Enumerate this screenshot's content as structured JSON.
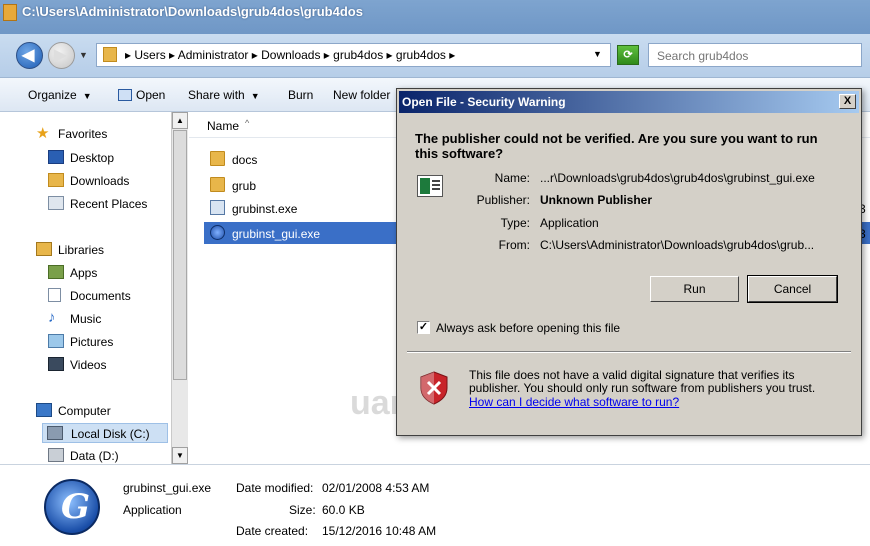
{
  "window": {
    "title": "C:\\Users\\Administrator\\Downloads\\grub4dos\\grub4dos"
  },
  "address": {
    "path": "▸ Users ▸ Administrator ▸ Downloads ▸ grub4dos ▸ grub4dos ▸",
    "search_placeholder": "Search grub4dos"
  },
  "toolbar": {
    "organize": "Organize",
    "open": "Open",
    "share_with": "Share with",
    "burn": "Burn",
    "new_folder": "New folder"
  },
  "nav": {
    "favorites": "Favorites",
    "desktop": "Desktop",
    "downloads": "Downloads",
    "recent_places": "Recent Places",
    "libraries": "Libraries",
    "apps": "Apps",
    "documents": "Documents",
    "music": "Music",
    "pictures": "Pictures",
    "videos": "Videos",
    "computer": "Computer",
    "local_disk": "Local Disk (C:)",
    "data_d": "Data (D:)"
  },
  "filelist": {
    "column_name": "Name",
    "files": [
      {
        "name": "docs",
        "icon": "folder-icon"
      },
      {
        "name": "grub",
        "icon": "folder-icon"
      },
      {
        "name": "grubinst.exe",
        "icon": "exe-icon"
      },
      {
        "name": "grubinst_gui.exe",
        "icon": "app-icon",
        "selected": true
      }
    ],
    "partial_right_1": "3",
    "partial_right_2": "3"
  },
  "details": {
    "filename": "grubinst_gui.exe",
    "type": "Application",
    "date_modified_label": "Date modified:",
    "date_modified": "02/01/2008 4:53 AM",
    "size_label": "Size:",
    "size": "60.0 KB",
    "date_created_label": "Date created:",
    "date_created": "15/12/2016 10:48 AM"
  },
  "dialog": {
    "title": "Open File - Security Warning",
    "close": "X",
    "question": "The publisher could not be verified.  Are you sure you want to run this software?",
    "name_label": "Name:",
    "name": "...r\\Downloads\\grub4dos\\grub4dos\\grubinst_gui.exe",
    "publisher_label": "Publisher:",
    "publisher": "Unknown Publisher",
    "type_label": "Type:",
    "type": "Application",
    "from_label": "From:",
    "from": "C:\\Users\\Administrator\\Downloads\\grub4dos\\grub...",
    "run_label": "Run",
    "cancel_label": "Cancel",
    "always_ask_label": "Always ask before opening this file",
    "always_ask_checked": true,
    "check_mark": "✓",
    "warning_text": "This file does not have a valid digital signature that verifies its publisher.  You should only run software from publishers you trust.",
    "help_link": "How can I decide what software to run?"
  },
  "watermark": "uantrimang"
}
